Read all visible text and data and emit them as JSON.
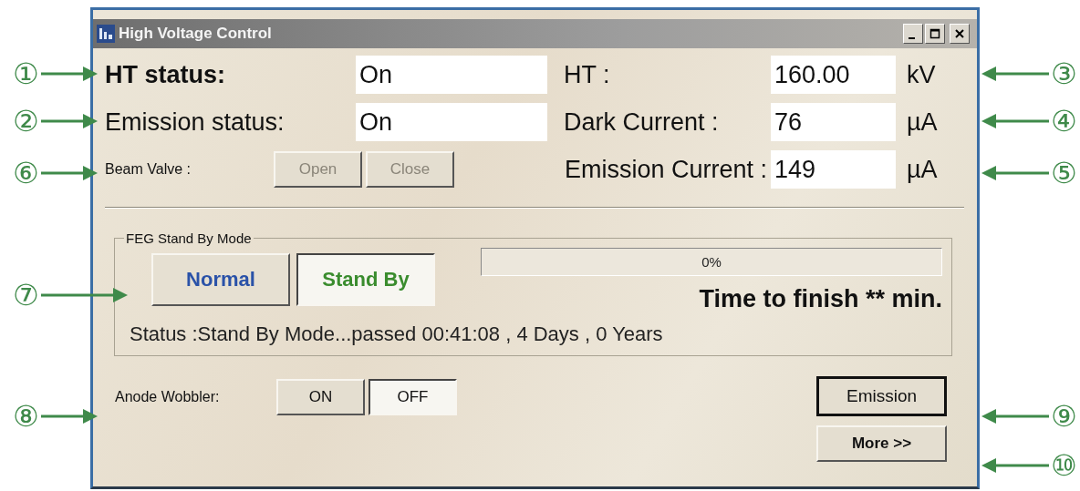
{
  "window": {
    "title": "High Voltage Control"
  },
  "status_fields": [
    {
      "label": "HT status:",
      "value": "On"
    },
    {
      "label": "Emission status:",
      "value": "On"
    }
  ],
  "readings": [
    {
      "label": "HT :",
      "value": "160.00",
      "unit": "kV"
    },
    {
      "label": "Dark Current :",
      "value": "76",
      "unit": "µA"
    },
    {
      "label": "Emission Current :",
      "value": "149",
      "unit": "µA"
    }
  ],
  "beam_valve": {
    "label": "Beam Valve :",
    "buttons": [
      {
        "label": "Open",
        "disabled": true
      },
      {
        "label": "Close",
        "disabled": true
      }
    ]
  },
  "standby": {
    "title": "FEG Stand By Mode",
    "modes": [
      {
        "label": "Normal",
        "selected": false,
        "color": "#2a52a8"
      },
      {
        "label": "Stand By",
        "selected": true,
        "color": "#3a8c2e"
      }
    ],
    "progress": {
      "level": 0,
      "reading": "0%"
    },
    "time_left": "Time to finish ** min.",
    "status": "Status :Stand By Mode...passed 00:41:08 , 4 Days , 0 Years"
  },
  "anode_wobbler": {
    "label": "Anode Wobbler:",
    "options": [
      {
        "label": "ON",
        "selected": false
      },
      {
        "label": "OFF",
        "selected": true
      }
    ]
  },
  "buttons": [
    {
      "label": "Emission",
      "default": true
    },
    {
      "label": "More >>",
      "default": false
    }
  ],
  "left_callouts": [
    "①",
    "②",
    "⑥",
    "⑦",
    "⑧"
  ],
  "right_callouts": [
    "③",
    "④",
    "⑤",
    "⑨",
    "⑩"
  ]
}
